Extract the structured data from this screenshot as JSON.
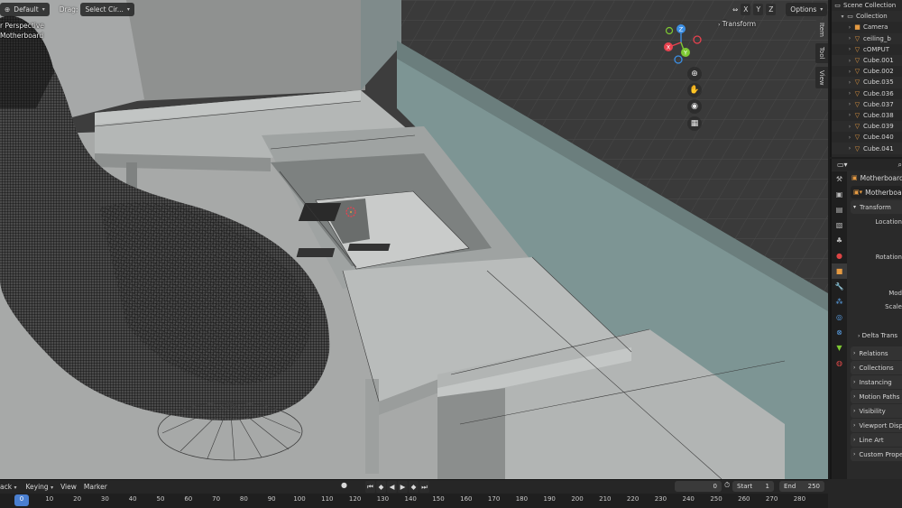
{
  "viewport": {
    "header": {
      "orientation": "Default",
      "drag_label": "Drag:",
      "drag_value": "Select Cir...",
      "axes": [
        "X",
        "Y",
        "Z"
      ],
      "options_label": "Options"
    },
    "overlay": {
      "perspective": "r Perspective",
      "object": "Motherboard"
    },
    "sidebar": {
      "transform_label": "Transform",
      "tabs": [
        "Item",
        "Tool",
        "View"
      ]
    },
    "gizmo": {
      "x": "X",
      "y": "Y",
      "z": "Z"
    }
  },
  "outliner": {
    "root": "Scene Collection",
    "collection": "Collection",
    "items": [
      {
        "label": "Camera",
        "icon": "camera-icon"
      },
      {
        "label": "ceiling_b",
        "icon": "mesh-icon"
      },
      {
        "label": "cOMPUT",
        "icon": "mesh-icon"
      },
      {
        "label": "Cube.001",
        "icon": "mesh-icon"
      },
      {
        "label": "Cube.002",
        "icon": "mesh-icon"
      },
      {
        "label": "Cube.035",
        "icon": "mesh-icon"
      },
      {
        "label": "Cube.036",
        "icon": "mesh-icon"
      },
      {
        "label": "Cube.037",
        "icon": "mesh-icon"
      },
      {
        "label": "Cube.038",
        "icon": "mesh-icon"
      },
      {
        "label": "Cube.039",
        "icon": "mesh-icon"
      },
      {
        "label": "Cube.040",
        "icon": "mesh-icon"
      },
      {
        "label": "Cube.041",
        "icon": "mesh-icon"
      }
    ]
  },
  "properties": {
    "object_name": "Motherboard",
    "object_name_field": "Motherboa",
    "transform": "Transform",
    "location": "Location",
    "rotation": "Rotation",
    "mode": "Mod",
    "scale": "Scale",
    "delta": "Delta Trans",
    "panels": [
      "Relations",
      "Collections",
      "Instancing",
      "Motion Paths",
      "Visibility",
      "Viewport Displ",
      "Line Art",
      "Custom Prope"
    ]
  },
  "timeline": {
    "playback": "ack",
    "keying": "Keying",
    "view": "View",
    "marker": "Marker",
    "current_frame": "0",
    "start_label": "Start",
    "start_value": "1",
    "end_label": "End",
    "end_value": "250",
    "ruler": [
      "0",
      "10",
      "20",
      "30",
      "40",
      "50",
      "60",
      "70",
      "80",
      "90",
      "100",
      "110",
      "120",
      "130",
      "140",
      "150",
      "160",
      "170",
      "180",
      "190",
      "200",
      "210",
      "220",
      "230",
      "240",
      "250",
      "260",
      "270",
      "280"
    ]
  },
  "colors": {
    "viewport_bg": "#3c3c3c",
    "accent_orange": "#e59a42",
    "x_axis": "#e8424f",
    "y_axis": "#7ec933",
    "z_axis": "#3c8fe4",
    "current_frame": "#4a7fd0"
  }
}
